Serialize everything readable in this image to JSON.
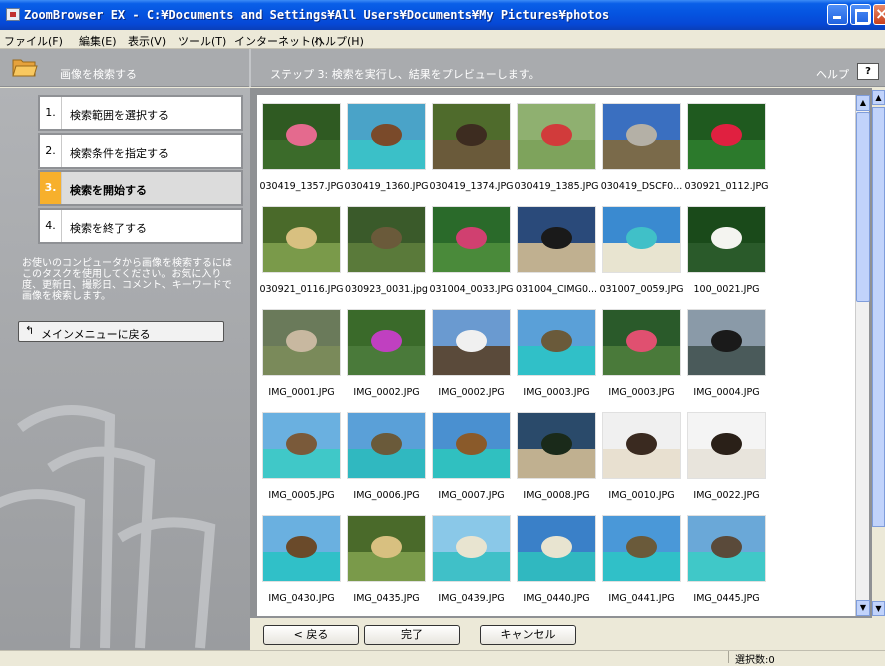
{
  "window": {
    "title": "ZoomBrowser EX  -  C:¥Documents and Settings¥All Users¥Documents¥My Pictures¥photos"
  },
  "menu": [
    "ファイル(F)",
    "編集(E)",
    "表示(V)",
    "ツール(T)",
    "インターネット(I)",
    "ヘルプ(H)"
  ],
  "header": {
    "section_title": "画像を検索する",
    "step_text": "ステップ 3:  検索を実行し、結果をプレビューします。",
    "help_label": "ヘルプ",
    "help_button": "?"
  },
  "steps": [
    {
      "num": "1.",
      "label": "検索範囲を選択する"
    },
    {
      "num": "2.",
      "label": "検索条件を指定する"
    },
    {
      "num": "3.",
      "label": "検索を開始する"
    },
    {
      "num": "4.",
      "label": "検索を終了する"
    }
  ],
  "description": "お使いのコンピュータから画像を検索するにはこのタスクを使用してください。お気に入り度、更新日、撮影日、コメント、キーワードで画像を検索します。",
  "back_to_menu": "メインメニューに戻る",
  "thumbnails": [
    {
      "name": "030419_1357.JPG",
      "colors": [
        "#2f5a22",
        "#3b6b2a",
        "#e46a8e"
      ]
    },
    {
      "name": "030419_1360.JPG",
      "colors": [
        "#4aa3c8",
        "#3bc0c8",
        "#7a4a2a"
      ]
    },
    {
      "name": "030419_1374.JPG",
      "colors": [
        "#4f6b2c",
        "#6a5a3a",
        "#3d2c20"
      ]
    },
    {
      "name": "030419_1385.JPG",
      "colors": [
        "#8fb070",
        "#7ea35c",
        "#d13b3b"
      ]
    },
    {
      "name": "030419_DSCF0...",
      "colors": [
        "#3a6fc0",
        "#7a6a4a",
        "#b4b0a6"
      ]
    },
    {
      "name": "030921_0112.JPG",
      "colors": [
        "#1f5a1f",
        "#2c7a2c",
        "#e02040"
      ]
    },
    {
      "name": "030921_0116.JPG",
      "colors": [
        "#4a6a2a",
        "#7a9a4a",
        "#d8c080"
      ]
    },
    {
      "name": "030923_0031.jpg",
      "colors": [
        "#3a5a2a",
        "#5a7a3a",
        "#6a5a3a"
      ]
    },
    {
      "name": "031004_0033.JPG",
      "colors": [
        "#2a6a2a",
        "#4a8a3a",
        "#d04070"
      ]
    },
    {
      "name": "031004_CIMG0...",
      "colors": [
        "#2a4a7a",
        "#c0b090",
        "#1a1a1a"
      ]
    },
    {
      "name": "031007_0059.JPG",
      "colors": [
        "#3a8ad0",
        "#e8e4d0",
        "#40c0c8"
      ]
    },
    {
      "name": "100_0021.JPG",
      "colors": [
        "#1a4a1a",
        "#2a5a2a",
        "#f4f4f0"
      ]
    },
    {
      "name": "IMG_0001.JPG",
      "colors": [
        "#6a7a5a",
        "#7a8a5a",
        "#c8b8a0"
      ]
    },
    {
      "name": "IMG_0002.JPG",
      "colors": [
        "#3a6a2a",
        "#4a7a3a",
        "#c040c0"
      ]
    },
    {
      "name": "IMG_0002.JPG",
      "colors": [
        "#6a9ad0",
        "#5a4a3a",
        "#f0f0f0"
      ]
    },
    {
      "name": "IMG_0003.JPG",
      "colors": [
        "#5aa0d8",
        "#30c0c8",
        "#6a5a3a"
      ]
    },
    {
      "name": "IMG_0003.JPG",
      "colors": [
        "#2a5a2a",
        "#4a7a3a",
        "#e05070"
      ]
    },
    {
      "name": "IMG_0004.JPG",
      "colors": [
        "#8a9aa8",
        "#4a5a5a",
        "#1a1a1a"
      ]
    },
    {
      "name": "IMG_0005.JPG",
      "colors": [
        "#6ab0e0",
        "#40c8c8",
        "#7a5a3a"
      ]
    },
    {
      "name": "IMG_0006.JPG",
      "colors": [
        "#5aa0d8",
        "#30b8c0",
        "#6a5a3a"
      ]
    },
    {
      "name": "IMG_0007.JPG",
      "colors": [
        "#4a90d0",
        "#30c0c0",
        "#8a5a2a"
      ]
    },
    {
      "name": "IMG_0008.JPG",
      "colors": [
        "#2a4a6a",
        "#c0b090",
        "#1a2a1a"
      ]
    },
    {
      "name": "IMG_0010.JPG",
      "colors": [
        "#f0f0f0",
        "#e8e0d0",
        "#3a2a20"
      ]
    },
    {
      "name": "IMG_0022.JPG",
      "colors": [
        "#f4f4f4",
        "#e8e4dc",
        "#2a2018"
      ]
    },
    {
      "name": "IMG_0430.JPG",
      "colors": [
        "#6ab0e0",
        "#30c0c8",
        "#6a4a2a"
      ]
    },
    {
      "name": "IMG_0435.JPG",
      "colors": [
        "#4a6a2a",
        "#7a9a4a",
        "#d8c080"
      ]
    },
    {
      "name": "IMG_0439.JPG",
      "colors": [
        "#8ac8e8",
        "#40c0c8",
        "#e8e4d0"
      ]
    },
    {
      "name": "IMG_0440.JPG",
      "colors": [
        "#3a80c8",
        "#30b8c0",
        "#e8e4d0"
      ]
    },
    {
      "name": "IMG_0441.JPG",
      "colors": [
        "#4a98d8",
        "#30c0c8",
        "#6a5a3a"
      ]
    },
    {
      "name": "IMG_0445.JPG",
      "colors": [
        "#6aa8d8",
        "#40c8c8",
        "#5a4a3a"
      ]
    }
  ],
  "buttons": {
    "back": "< 戻る",
    "finish": "完了",
    "cancel": "キャンセル"
  },
  "status": {
    "selection": "選択数:0"
  }
}
